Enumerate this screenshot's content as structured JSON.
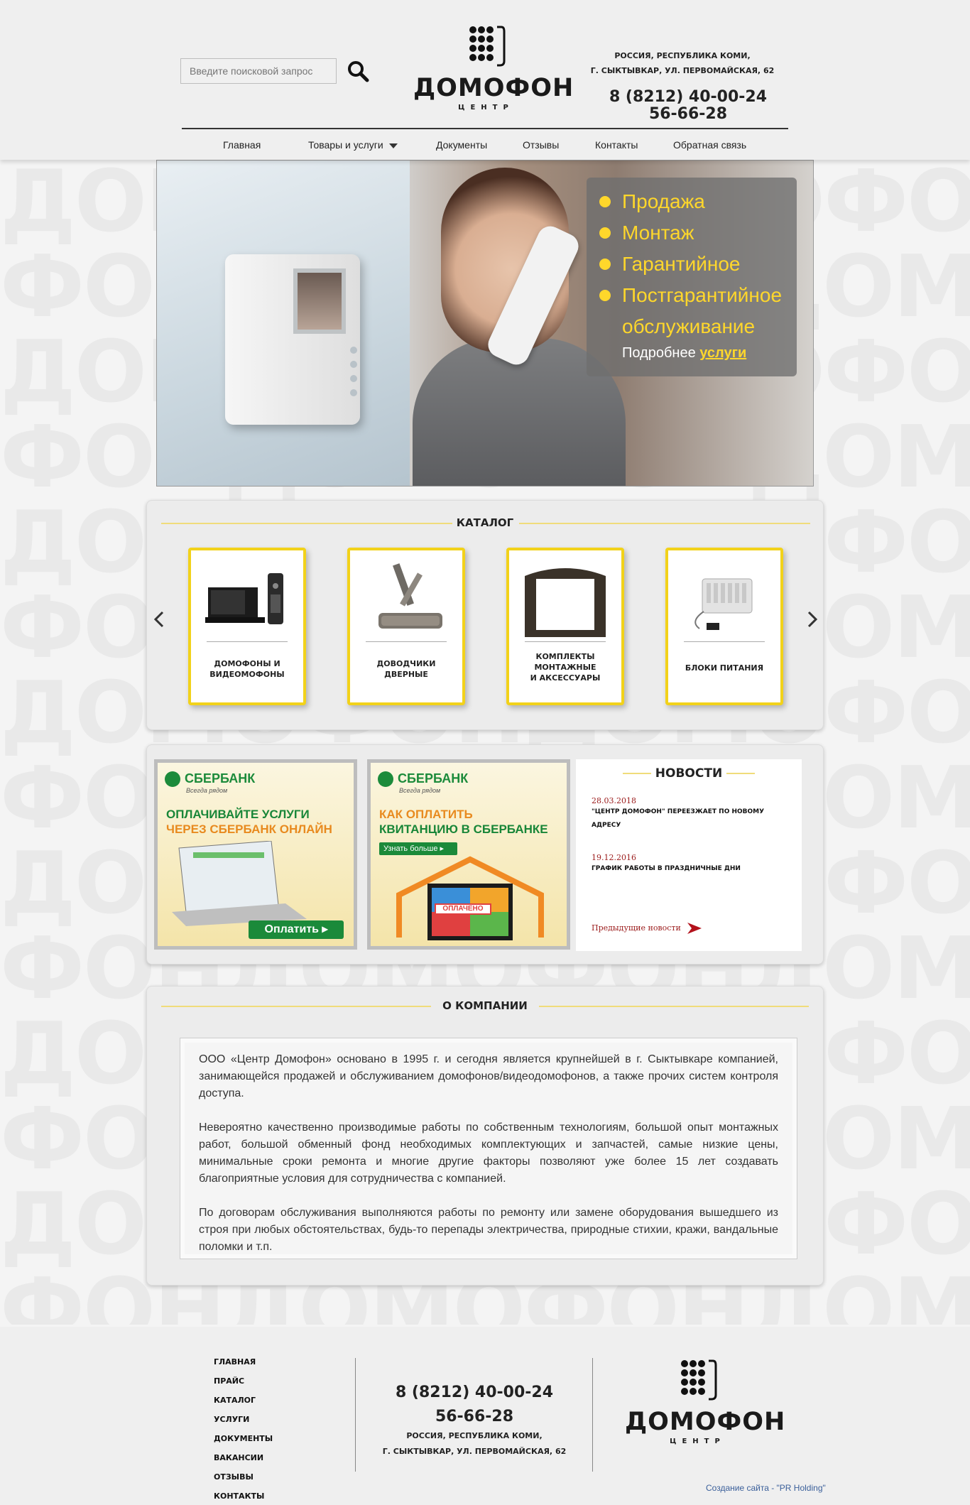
{
  "search": {
    "placeholder": "Введите поисковой запрос"
  },
  "logo": {
    "title": "ДОМОФОН",
    "subtitle": "ЦЕНТР"
  },
  "header": {
    "address_line1": "РОССИЯ, РЕСПУБЛИКА КОМИ,",
    "address_line2": "Г. СЫКТЫВКАР, УЛ. ПЕРВОМАЙСКАЯ, 62",
    "phone1": "8 (8212) 40-00-24",
    "phone2": "56-66-28"
  },
  "nav": {
    "items": [
      {
        "label": "Главная"
      },
      {
        "label": "Товары и услуги"
      },
      {
        "label": "Документы"
      },
      {
        "label": "Отзывы"
      },
      {
        "label": "Контакты"
      },
      {
        "label": "Обратная связь"
      }
    ]
  },
  "hero": {
    "items": [
      "Продажа",
      "Монтаж",
      "Гарантийное",
      "Постгарантийное",
      "обслуживание"
    ],
    "more_text": "Подробнее",
    "more_link": "услуги"
  },
  "catalog": {
    "title": "КАТАЛОГ",
    "cards": [
      {
        "line1": "ДОМОФОНЫ И",
        "line2": "ВИДЕОМОФОНЫ",
        "line3": ""
      },
      {
        "line1": "ДОВОДЧИКИ",
        "line2": "ДВЕРНЫЕ",
        "line3": ""
      },
      {
        "line1": "КОМПЛЕКТЫ",
        "line2": "МОНТАЖНЫЕ",
        "line3": "И АКСЕССУАРЫ"
      },
      {
        "line1": "БЛОКИ ПИТАНИЯ",
        "line2": "",
        "line3": ""
      }
    ]
  },
  "banners": {
    "b1": {
      "brand": "СБЕРБАНК",
      "tagline": "Всегда рядом",
      "line1": "ОПЛАЧИВАЙТЕ УСЛУГИ",
      "line2": "ЧЕРЕЗ СБЕРБАНК ОНЛАЙН",
      "button": "Оплатить ▸"
    },
    "b2": {
      "brand": "СБЕРБАНК",
      "tagline": "Всегда рядом",
      "line1": "КАК ОПЛАТИТЬ",
      "line2": "КВИТАНЦИЮ В СБЕРБАНКЕ",
      "button": "Узнать больше ▸",
      "stamp": "ОПЛАЧЕНО"
    }
  },
  "news": {
    "title": "НОВОСТИ",
    "items": [
      {
        "date": "28.03.2018",
        "text": "\"ЦЕНТР ДОМОФОН\" ПЕРЕЕЗЖАЕТ ПО НОВОМУ АДРЕСУ"
      },
      {
        "date": "19.12.2016",
        "text": "ГРАФИК РАБОТЫ В ПРАЗДНИЧНЫЕ ДНИ"
      }
    ],
    "prev": "Предыдущие новости"
  },
  "about": {
    "title": "О КОМПАНИИ",
    "p1": "ООО «Центр Домофон» основано в 1995 г. и сегодня является крупнейшей в г. Сыктывкаре компанией, занимающейся продажей и обслуживанием домофонов/видеодомофонов, а также прочих систем контроля доступа.",
    "p2": "Невероятно качественно производимые работы по собственным технологиям, большой опыт монтажных работ, большой обменный фонд необходимых комплектующих и запчастей, самые низкие цены, минимальные сроки ремонта и многие другие факторы позволяют уже более 15 лет создавать благоприятные условия для сотрудничества с компанией.",
    "p3": "По договорам обслуживания выполняются работы по ремонту или замене оборудования вышедшего из строя при любых обстоятельствах, будь-то перепады электричества, природные стихии, кражи, вандальные поломки и т.п."
  },
  "footer": {
    "links": [
      "ГЛАВНАЯ",
      "ПРАЙС",
      "КАТАЛОГ",
      "УСЛУГИ",
      "ДОКУМЕНТЫ",
      "ВАКАНСИИ",
      "ОТЗЫВЫ",
      "КОНТАКТЫ"
    ],
    "phone1": "8 (8212) 40-00-24",
    "phone2": "56-66-28",
    "address_line1": "РОССИЯ, РЕСПУБЛИКА КОМИ,",
    "address_line2": "Г. СЫКТЫВКАР, УЛ. ПЕРВОМАЙСКАЯ, 62",
    "credit": "Создание сайта - \"PR Holding\""
  },
  "colors": {
    "accent": "#ffd72b",
    "card_border": "#f2d21a",
    "news_red": "#9b1b1b",
    "sber_green": "#1c8b3b"
  },
  "icons": [
    "search-icon",
    "logo-dots-icon",
    "chevron-down-icon",
    "arrow-left-icon",
    "arrow-right-icon",
    "red-arrow-icon"
  ]
}
